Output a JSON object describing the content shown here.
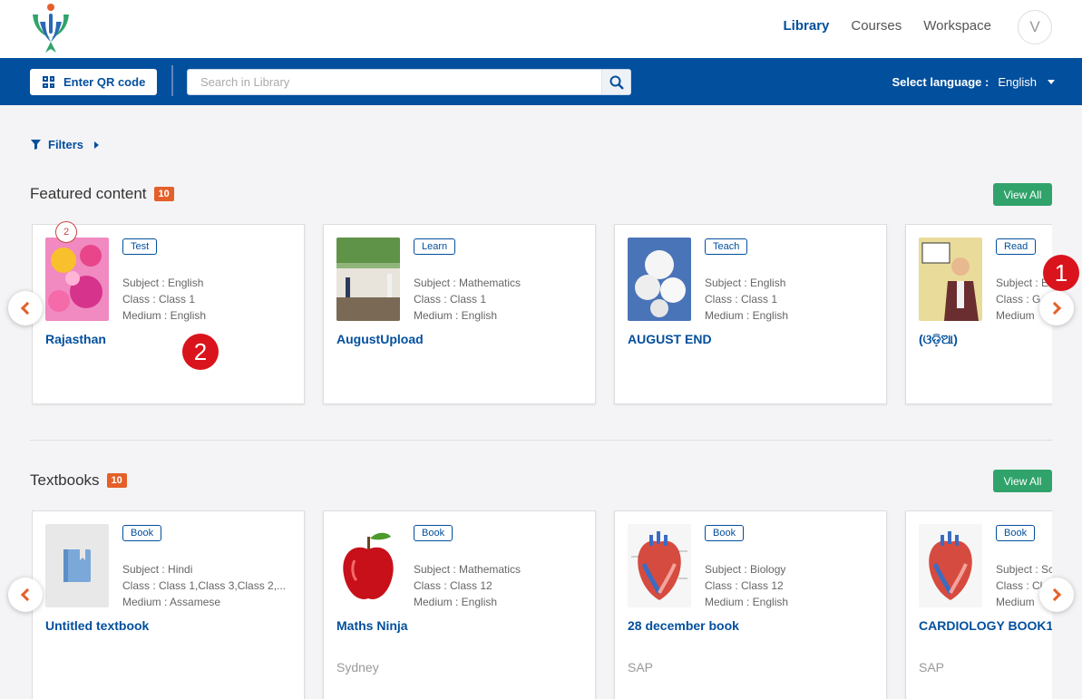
{
  "header": {
    "nav": [
      "Library",
      "Courses",
      "Workspace"
    ],
    "avatar_initial": "V"
  },
  "bluebar": {
    "qr_label": "Enter QR code",
    "search_placeholder": "Search in Library",
    "lang_label": "Select language :",
    "lang_value": "English"
  },
  "filters_label": "Filters",
  "featured": {
    "title": "Featured content",
    "count": "10",
    "view_all": "View All",
    "cards": [
      {
        "tag": "Test",
        "subject": "Subject : English",
        "class": "Class : Class 1",
        "medium": "Medium : English",
        "title": "Rajasthan"
      },
      {
        "tag": "Learn",
        "subject": "Subject : Mathematics",
        "class": "Class : Class 1",
        "medium": "Medium : English",
        "title": "AugustUpload"
      },
      {
        "tag": "Teach",
        "subject": "Subject : English",
        "class": "Class : Class 1",
        "medium": "Medium : English",
        "title": "AUGUST END"
      },
      {
        "tag": "Read",
        "subject": "Subject : E",
        "class": "Class : G",
        "medium": "Medium",
        "title": "(ଓଡ଼ିଆ)"
      }
    ]
  },
  "textbooks": {
    "title": "Textbooks",
    "count": "10",
    "view_all": "View All",
    "cards": [
      {
        "tag": "Book",
        "subject": "Subject : Hindi",
        "class": "Class : Class 1,Class 3,Class 2,...",
        "medium": "Medium : Assamese",
        "title": "Untitled textbook",
        "org": ""
      },
      {
        "tag": "Book",
        "subject": "Subject : Mathematics",
        "class": "Class : Class 12",
        "medium": "Medium : English",
        "title": "Maths Ninja",
        "org": "Sydney"
      },
      {
        "tag": "Book",
        "subject": "Subject : Biology",
        "class": "Class : Class 12",
        "medium": "Medium : English",
        "title": "28 december book",
        "org": "SAP"
      },
      {
        "tag": "Book",
        "subject": "Subject : Sc",
        "class": "Class : Cl",
        "medium": "Medium",
        "title": "CARDIOLOGY BOOK1",
        "org": "SAP"
      }
    ]
  },
  "annotations": {
    "marker_1": "1",
    "marker_2": "2",
    "mini_marker": "2"
  },
  "colors": {
    "primary": "#024f9d",
    "accent": "#e4602a",
    "success": "#30a36b",
    "marker": "#d9141c"
  }
}
